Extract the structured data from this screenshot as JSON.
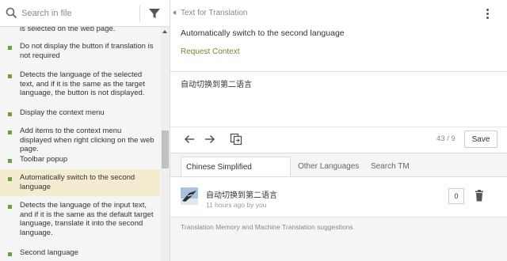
{
  "search": {
    "placeholder": "Search in file"
  },
  "strings": [
    {
      "text": "is selected on the web page.",
      "active": false,
      "bullet": false
    },
    {
      "text": "Do not display the button if translation is not required",
      "active": false,
      "bullet": true
    },
    {
      "text": "Detects the language of the selected text, and if it is the same as the target language, the button is not displayed.",
      "active": false,
      "bullet": true
    },
    {
      "text": "Display the context menu",
      "active": false,
      "bullet": true
    },
    {
      "text": "Add items to the context menu displayed when right clicking on the web page.",
      "active": false,
      "bullet": true
    },
    {
      "text": "Toolbar popup",
      "active": false,
      "bullet": true
    },
    {
      "text": "Automatically switch to the second language",
      "active": true,
      "bullet": true
    },
    {
      "text": "Detects the language of the input text, and if it is the same as the default target language, translate it into the second language.",
      "active": false,
      "bullet": true
    },
    {
      "text": "Second language",
      "active": false,
      "bullet": true
    }
  ],
  "source": {
    "title": "Text for Translation",
    "text": "Automatically switch to the second language",
    "request_context": "Request Context"
  },
  "translation": {
    "text": "自动切换到第二语言"
  },
  "toolbar": {
    "counter": "43 / 9",
    "save_label": "Save"
  },
  "tabs": [
    {
      "label": "Chinese Simplified Sugges...",
      "active": true
    },
    {
      "label": "Other Languages",
      "active": false
    },
    {
      "label": "Search TM",
      "active": false
    }
  ],
  "suggestion": {
    "text": "自动切换到第二语言",
    "meta": "11 hours ago by you",
    "votes": "0"
  },
  "tm_caption": "Translation Memory and Machine Translation suggestions",
  "colors": {
    "accent": "#6ba03d",
    "active_row": "#f4ecd0",
    "link": "#6a8f2f"
  }
}
